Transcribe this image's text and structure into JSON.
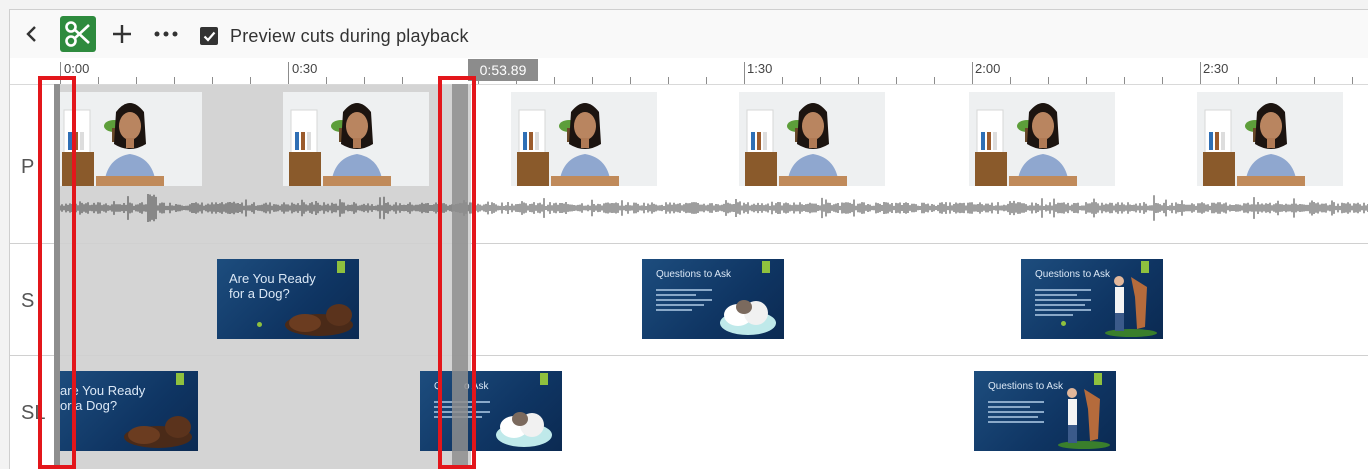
{
  "toolbar": {
    "back_icon": "chevron-left-icon",
    "scissors_icon": "scissors-icon",
    "add_icon": "plus-icon",
    "more_icon": "more-icon",
    "preview_checkbox": {
      "label": "Preview cuts during playback",
      "checked": true
    }
  },
  "ruler": {
    "labels": [
      "0:00",
      "0:30",
      "1:30",
      "2:00",
      "2:30"
    ],
    "playhead": "0:53.89",
    "partial_label": "0"
  },
  "tracks": [
    {
      "label": "P"
    },
    {
      "label": "S"
    },
    {
      "label": "SL"
    }
  ],
  "slides": {
    "ready_title": "Are You Ready for a Dog?",
    "ready_title_cut": "are You Ready or a Dog?",
    "questions_title": "Questions to Ask",
    "questions_title_cut": "Q        o Ask"
  },
  "colors": {
    "scissors_bg": "#2e8b3e",
    "highlight": "#e3161b",
    "slide_blue": "#1d4d7e",
    "slide_accent": "#8fc13e"
  }
}
